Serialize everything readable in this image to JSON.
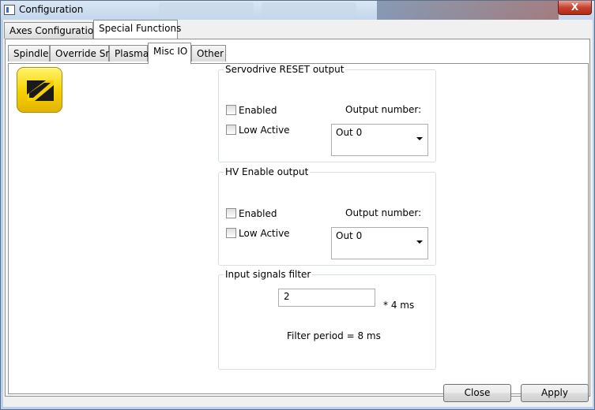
{
  "window": {
    "title": "Configuration",
    "close_glyph": "X"
  },
  "outer_tabs": [
    {
      "label": "Axes Configuration",
      "active": false
    },
    {
      "label": "Special Functions",
      "active": true
    }
  ],
  "inner_tabs": [
    {
      "label": "Spindle",
      "active": false
    },
    {
      "label": "Override Src",
      "active": false
    },
    {
      "label": "Plasma",
      "active": false
    },
    {
      "label": "Misc IO",
      "active": true
    },
    {
      "label": "Other",
      "active": false
    }
  ],
  "logo": {
    "icon": "yellow-app-logo-icon",
    "accent": "#f5d000"
  },
  "servo_group": {
    "title": "Servodrive RESET output",
    "enabled_label": "Enabled",
    "enabled_checked": false,
    "low_active_label": "Low Active",
    "low_active_checked": false,
    "output_label": "Output number:",
    "output_value": "Out 0"
  },
  "hv_group": {
    "title": "HV Enable output",
    "enabled_label": "Enabled",
    "enabled_checked": false,
    "low_active_label": "Low Active",
    "low_active_checked": false,
    "output_label": "Output number:",
    "output_value": "Out 0"
  },
  "filter_group": {
    "title": "Input signals filter",
    "value": "2",
    "unit": "* 4 ms",
    "period_text": "Filter period = 8 ms"
  },
  "footer": {
    "close_label": "Close",
    "apply_label": "Apply"
  }
}
